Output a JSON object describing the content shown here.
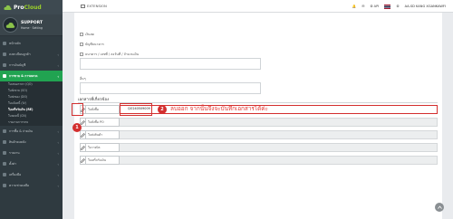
{
  "brand": {
    "name_part1": "Pro",
    "name_part2": "Cloud",
    "accent": "#8bc34a"
  },
  "profile": {
    "name": "SUPPORT",
    "subtitle": "Home  ·  Setting"
  },
  "sidebar": {
    "items": [
      {
        "label": "หน้าหลัก",
        "icon": "home-icon"
      },
      {
        "label": "ลงทะเบียนลูกค้า",
        "icon": "users-icon",
        "chevron": "‹"
      },
      {
        "label": "การเงินบัญชี",
        "icon": "wallet-icon",
        "chevron": "‹"
      },
      {
        "label": "การขาย & การตลาด",
        "icon": "cart-icon",
        "chevron": "‹",
        "active": true
      }
    ],
    "subitems": [
      {
        "label": "ใบเสนอราคา (QO)"
      },
      {
        "label": "ใบสั่งขาย (SO)"
      },
      {
        "label": "ใบส่งของ (DO)"
      },
      {
        "label": "ใบแจ้งหนี้ (IV)"
      },
      {
        "label": "ใบเสร็จรับเงิน (RE)",
        "current": true
      },
      {
        "label": "ใบลดหนี้ (CN)"
      },
      {
        "label": "รายงานการขาย"
      }
    ],
    "items_after": [
      {
        "label": "การซื้อ & จ่ายเงิน",
        "icon": "basket-icon",
        "chevron": "‹"
      },
      {
        "label": "สินค้าคงคลัง",
        "icon": "box-icon",
        "chevron": "‹"
      },
      {
        "label": "รายงาน",
        "icon": "chart-icon",
        "chevron": "‹"
      },
      {
        "label": "ตั้งค่า",
        "icon": "gear-icon",
        "chevron": "‹"
      },
      {
        "label": "เครื่องมือ",
        "icon": "tool-icon",
        "chevron": "‹"
      },
      {
        "label": "ความช่วยเหลือ",
        "icon": "help-icon",
        "chevron": "‹"
      }
    ]
  },
  "topbar": {
    "extension": "EXTENSION",
    "api": "API",
    "user": "AA-SD KANG XGANKAWFI"
  },
  "main": {
    "checks": [
      {
        "label": "เงินสด"
      },
      {
        "label": "บัญชีธนาคาร"
      },
      {
        "label": "ธนาคาร / เลขที่ / ลงวันที่ / จำนวนเงิน"
      }
    ],
    "notes_label": "อื่นๆ",
    "section_title": "เอกสารที่เกี่ยวข้อง",
    "docs": [
      {
        "label": "ใบสั่งซื้อ",
        "value": "QO240509009",
        "active": true
      },
      {
        "label": "ใบสั่งซื้อ PO"
      },
      {
        "label": "ใบส่งสินค้า"
      },
      {
        "label": "ใบวางบิล"
      },
      {
        "label": "ใบเสร็จรับเงิน"
      }
    ],
    "annotation_1": "1",
    "annotation_2": "2",
    "instruction": "ลบออก  จากนั้นจึงจะบันทึกเอกสารได้ค่ะ",
    "accent_red": "#d32f2f"
  }
}
